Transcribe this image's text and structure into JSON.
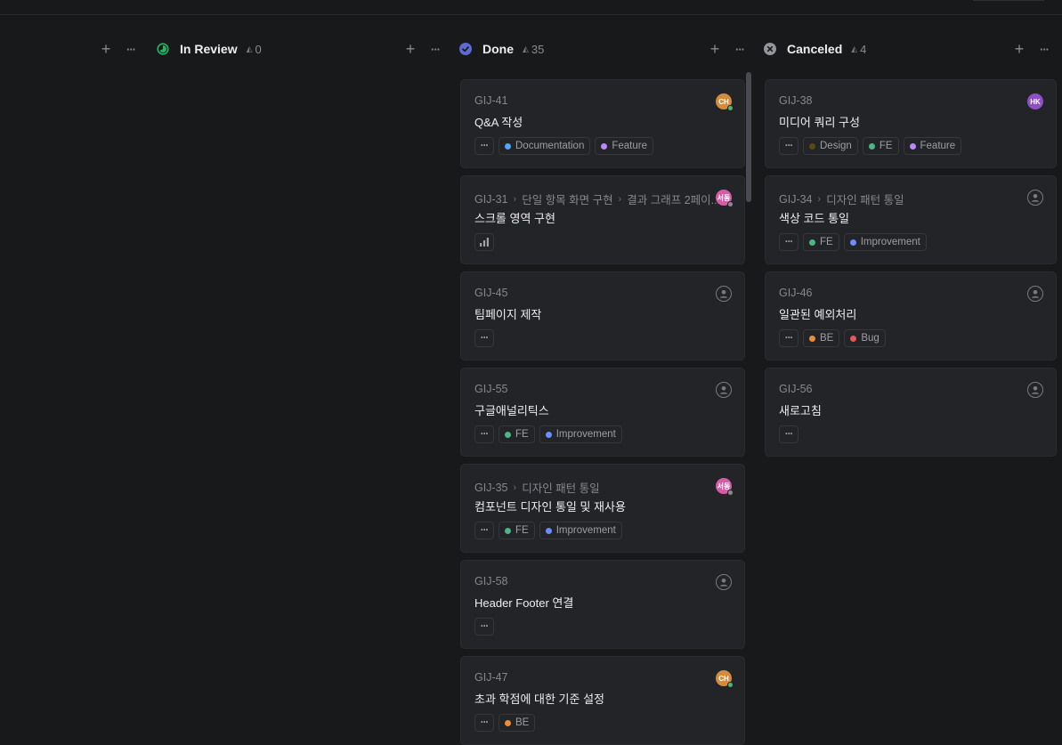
{
  "columns": {
    "in_review": {
      "title": "In Review",
      "count": "0",
      "color": "#26b55e"
    },
    "done": {
      "title": "Done",
      "count": "35",
      "color": "#5e6ad2"
    },
    "canceled": {
      "title": "Canceled",
      "count": "4",
      "color": "#95959a"
    }
  },
  "icons": {
    "add": "+",
    "more": "···",
    "count": "◭"
  },
  "labels": {
    "documentation": {
      "name": "Documentation",
      "color": "#4ea7fc"
    },
    "feature": {
      "name": "Feature",
      "color": "#bb87fc"
    },
    "fe": {
      "name": "FE",
      "color": "#4cb782"
    },
    "be": {
      "name": "BE",
      "color": "#eb8d36"
    },
    "improvement": {
      "name": "Improvement",
      "color": "#6c8cff"
    },
    "design": {
      "name": "Design",
      "color": "#5a4a12"
    },
    "bug": {
      "name": "Bug",
      "color": "#eb5757"
    }
  },
  "done_cards": [
    {
      "id": "GIJ-41",
      "title": "Q&A 작성",
      "avatar": "CH"
    },
    {
      "id": "GIJ-31",
      "crumb1": "단일 항목 화면 구현",
      "crumb2": "결과 그래프 2페이...",
      "title": "스크롤 영역 구현",
      "avatar": "서동"
    },
    {
      "id": "GIJ-45",
      "title": "팀페이지 제작"
    },
    {
      "id": "GIJ-55",
      "title": "구글애널리틱스"
    },
    {
      "id": "GIJ-35",
      "crumb1": "디자인 패턴 통일",
      "title": "컴포넌트 디자인 통일 및 재사용",
      "avatar": "서동"
    },
    {
      "id": "GIJ-58",
      "title": "Header Footer 연결"
    },
    {
      "id": "GIJ-47",
      "title": "초과 학점에 대한 기준 설정",
      "avatar": "CH"
    }
  ],
  "canceled_cards": [
    {
      "id": "GIJ-38",
      "title": "미디어 쿼리 구성",
      "avatar": "HK"
    },
    {
      "id": "GIJ-34",
      "crumb1": "디자인 패턴 통일",
      "title": "색상 코드 통일"
    },
    {
      "id": "GIJ-46",
      "title": "일관된 예외처리"
    },
    {
      "id": "GIJ-56",
      "title": "새로고침"
    }
  ]
}
